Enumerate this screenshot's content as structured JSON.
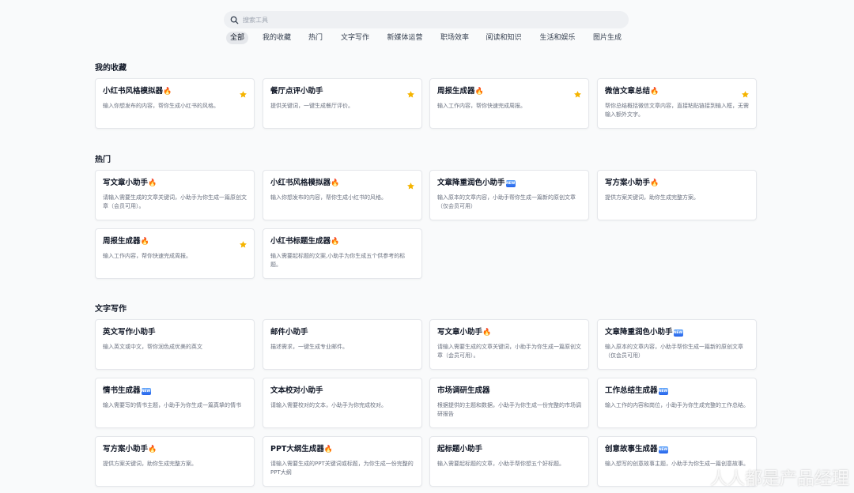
{
  "search": {
    "placeholder": "搜索工具"
  },
  "tabs": [
    "全部",
    "我的收藏",
    "热门",
    "文字写作",
    "新媒体运营",
    "职场效率",
    "阅读和知识",
    "生活和娱乐",
    "图片生成"
  ],
  "active_tab": "全部",
  "sections": [
    {
      "title": "我的收藏",
      "cards": [
        {
          "title": "小红书风格模拟器",
          "badge": "🔥",
          "desc": "输入你想发布的内容，帮你生成小红书的风格。",
          "starred": true
        },
        {
          "title": "餐厅点评小助手",
          "badge": "",
          "desc": "提供关键词，一键生成餐厅评价。",
          "starred": true
        },
        {
          "title": "周报生成器",
          "badge": "🔥",
          "desc": "输入工作内容，帮你快速完成周报。",
          "starred": true
        },
        {
          "title": "微信文章总结",
          "badge": "🔥",
          "desc": "帮你总结概括微信文章内容，直接粘贴链接到输入框，无需输入额外文字。",
          "starred": true
        }
      ]
    },
    {
      "title": "热门",
      "cards": [
        {
          "title": "写文章小助手",
          "badge": "🔥",
          "desc": "请输入需要生成的文章关键词，小助手为你生成一篇原创文章（会员可用）。",
          "starred": false
        },
        {
          "title": "小红书风格模拟器",
          "badge": "🔥",
          "desc": "输入你想发布的内容，帮你生成小红书的风格。",
          "starred": true
        },
        {
          "title": "文章降重润色小助手",
          "badge": "NEW",
          "desc": "输入原本的文章内容，小助手帮你生成一篇新的原创文章（仅会员可用）",
          "starred": false
        },
        {
          "title": "写方案小助手",
          "badge": "🔥",
          "desc": "提供方案关键词，助你生成完整方案。",
          "starred": false
        },
        {
          "title": "周报生成器",
          "badge": "🔥",
          "desc": "输入工作内容，帮你快速完成周报。",
          "starred": true
        },
        {
          "title": "小红书标题生成器",
          "badge": "🔥",
          "desc": "输入需要起标题的文案,小助手为你生成五个供参考的标题。",
          "starred": false
        }
      ]
    },
    {
      "title": "文字写作",
      "cards": [
        {
          "title": "英文写作小助手",
          "badge": "",
          "desc": "输入英文或中文，帮你润色成优美的英文",
          "starred": false
        },
        {
          "title": "邮件小助手",
          "badge": "",
          "desc": "描述需求，一键生成专业邮件。",
          "starred": false
        },
        {
          "title": "写文章小助手",
          "badge": "🔥",
          "desc": "请输入需要生成的文章关键词，小助手为你生成一篇原创文章（会员可用）。",
          "starred": false
        },
        {
          "title": "文章降重润色小助手",
          "badge": "NEW",
          "desc": "输入原本的文章内容，小助手帮你生成一篇新的原创文章（仅会员可用）",
          "starred": false
        },
        {
          "title": "情书生成器",
          "badge": "NEW",
          "desc": "输入需要写的情书主题，小助手为你生成一篇真挚的情书",
          "starred": false
        },
        {
          "title": "文本校对小助手",
          "badge": "",
          "desc": "请输入需要校对的文本，小助手为你完成校对。",
          "starred": false
        },
        {
          "title": "市场调研生成器",
          "badge": "",
          "desc": "根据提供的主题和数据，小助手为你生成一份完整的市场调研报告",
          "starred": false
        },
        {
          "title": "工作总结生成器",
          "badge": "NEW",
          "desc": "输入工作的内容和岗位，小助手为你生成完整的工作总结。",
          "starred": false
        },
        {
          "title": "写方案小助手",
          "badge": "🔥",
          "desc": "提供方案关键词，助你生成完整方案。",
          "starred": false
        },
        {
          "title": "PPT大纲生成器",
          "badge": "🔥",
          "desc": "请输入需要生成的PPT关键词或标题，为你生成一份完整的PPT大纲",
          "starred": false
        },
        {
          "title": "起标题小助手",
          "badge": "",
          "desc": "输入需要起标题的文章，小助手帮你想五个好标题。",
          "starred": false
        },
        {
          "title": "创意故事生成器",
          "badge": "NEW",
          "desc": "输入想写的创意故事主题，小助手为你生成一篇创意故事。",
          "starred": false
        }
      ]
    }
  ],
  "watermark": "人人都是产品经理",
  "colors": {
    "star": "#f5b400",
    "new_badge": "#2563eb",
    "active_tab_bg": "#e5e7eb"
  },
  "icons": {
    "search": "search-icon",
    "star": "star-icon",
    "fire": "fire-emoji",
    "new": "new-badge-icon"
  }
}
